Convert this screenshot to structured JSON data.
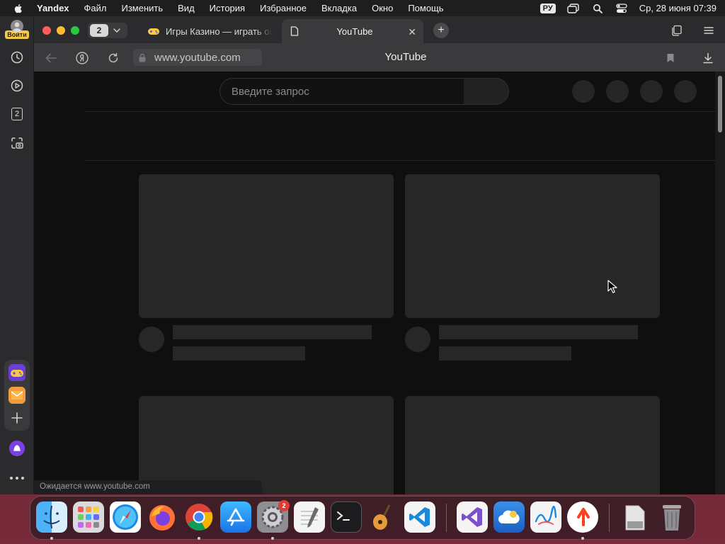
{
  "menubar": {
    "app_name": "Yandex",
    "items": [
      "Файл",
      "Изменить",
      "Вид",
      "История",
      "Избранное",
      "Вкладка",
      "Окно",
      "Помощь"
    ],
    "input_lang": "РУ",
    "datetime": "Ср, 28 июня  07:39"
  },
  "sidebar": {
    "login_label": "Войти",
    "tab_count": "2"
  },
  "tabs": {
    "group_count": "2",
    "inactive_title": "Игры Казино — играть онлайн",
    "active_title": "YouTube"
  },
  "address": {
    "url": "www.youtube.com",
    "page_title": "YouTube"
  },
  "page": {
    "search_placeholder": "Введите запрос",
    "status_text": "Ожидается www.youtube.com"
  },
  "dock": {
    "settings_badge": "2",
    "apps": [
      "Finder",
      "Launchpad",
      "Safari",
      "Firefox",
      "Google Chrome",
      "App Store",
      "System Preferences",
      "TextEdit",
      "Terminal",
      "GarageBand",
      "Visual Studio Code",
      "Visual Studio",
      "iCloud",
      "Freeform",
      "Yandex",
      "Downloads",
      "Trash"
    ]
  },
  "colors": {
    "accent_yellow": "#f7c948",
    "alice_purple": "#7b3fe4",
    "yandex_red": "#fc3f1d"
  }
}
